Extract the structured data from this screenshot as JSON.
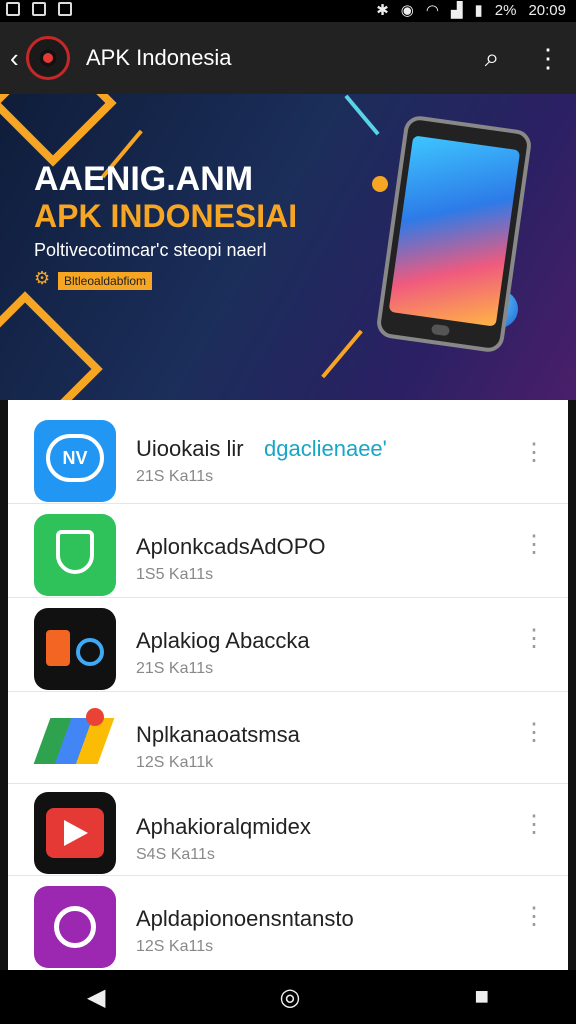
{
  "status": {
    "battery": "2%",
    "time": "20:09"
  },
  "appbar": {
    "title": "APK Indonesia"
  },
  "banner": {
    "heading1": "AAENIG.ANM",
    "heading2": "APK INDONESIAI",
    "subtitle": "Poltivecotimcar'c steopi naerl",
    "badge": "Bltleoaldabfiom"
  },
  "apps": [
    {
      "name": "Uiookais lir",
      "accent": "dgaclienaee'",
      "meta": "21S Ka11s",
      "icon": "nv-chat-icon",
      "color": "#2196f3"
    },
    {
      "name": "AplonkcadsAdOPO",
      "meta": "1S5 Ka11s",
      "icon": "shield-icon",
      "color": "#2fc25b"
    },
    {
      "name": "Aplakiog Abaccka",
      "meta": "21S Ka11s",
      "icon": "lock-icon",
      "color": "#111111"
    },
    {
      "name": "Nplkanaoatsmsa",
      "meta": "12S Ka11k",
      "icon": "maps-icon",
      "color": "#ffffff"
    },
    {
      "name": "Aphakioralqmidex",
      "meta": "S4S Ka11s",
      "icon": "play-icon",
      "color": "#111111"
    },
    {
      "name": "Apldapionoensntansto",
      "meta": "12S Ka11s",
      "icon": "camera-icon",
      "color": "#9c27b0"
    }
  ]
}
